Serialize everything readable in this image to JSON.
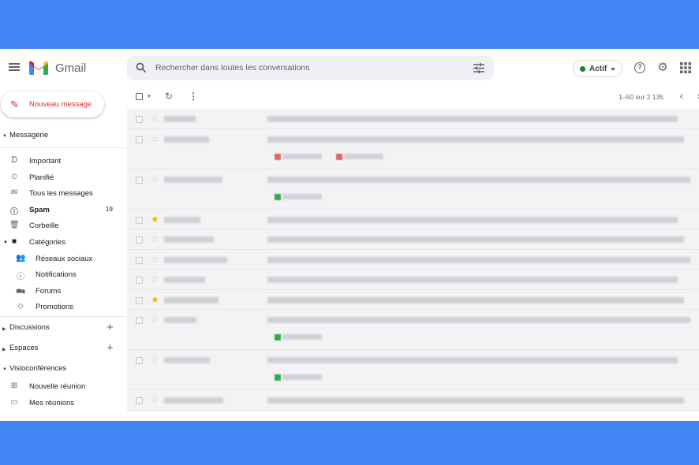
{
  "header": {
    "brand": "Gmail",
    "search_placeholder": "Rechercher dans toutes les conversations",
    "status": "Actif",
    "status_color": "#188038",
    "icons": [
      "menu-icon",
      "search-icon",
      "tune-icon",
      "help-icon",
      "gear-icon",
      "apps-icon"
    ]
  },
  "compose": {
    "label": "Nouveau message"
  },
  "sidebar": {
    "mail_section": "Messagerie",
    "items": [
      {
        "label": "Important",
        "icon": "important-icon"
      },
      {
        "label": "Planifié",
        "icon": "scheduled-icon"
      },
      {
        "label": "Tous les messages",
        "icon": "all-mail-icon"
      },
      {
        "label": "Spam",
        "icon": "spam-icon",
        "count": "19",
        "bold": true
      },
      {
        "label": "Corbeille",
        "icon": "trash-icon"
      },
      {
        "label": "Catégories",
        "icon": "label-icon"
      }
    ],
    "categories": [
      {
        "label": "Réseaux sociaux",
        "icon": "social-icon"
      },
      {
        "label": "Notifications",
        "icon": "info-icon"
      },
      {
        "label": "Forums",
        "icon": "forum-icon"
      },
      {
        "label": "Promotions",
        "icon": "tag-icon"
      }
    ],
    "discussions": "Discussions",
    "spaces": "Espaces",
    "meet_section": "Visioconférences",
    "meet_items": [
      {
        "label": "Nouvelle réunion",
        "icon": "video-icon"
      },
      {
        "label": "Mes réunions",
        "icon": "calendar-icon"
      }
    ]
  },
  "toolbar": {
    "pagination": "1–50 sur 2 135"
  },
  "rows": [
    {
      "starred": false,
      "chips": []
    },
    {
      "starred": false,
      "chips": [
        "#e06666",
        "#e06666"
      ]
    },
    {
      "starred": false,
      "chips": [
        "#34a853"
      ]
    },
    {
      "starred": true,
      "chips": []
    },
    {
      "starred": false,
      "chips": []
    },
    {
      "starred": false,
      "chips": []
    },
    {
      "starred": false,
      "chips": []
    },
    {
      "starred": true,
      "chips": []
    },
    {
      "starred": false,
      "chips": [
        "#34a853"
      ]
    },
    {
      "starred": false,
      "chips": [
        "#34a853"
      ]
    },
    {
      "starred": false,
      "chips": []
    }
  ]
}
